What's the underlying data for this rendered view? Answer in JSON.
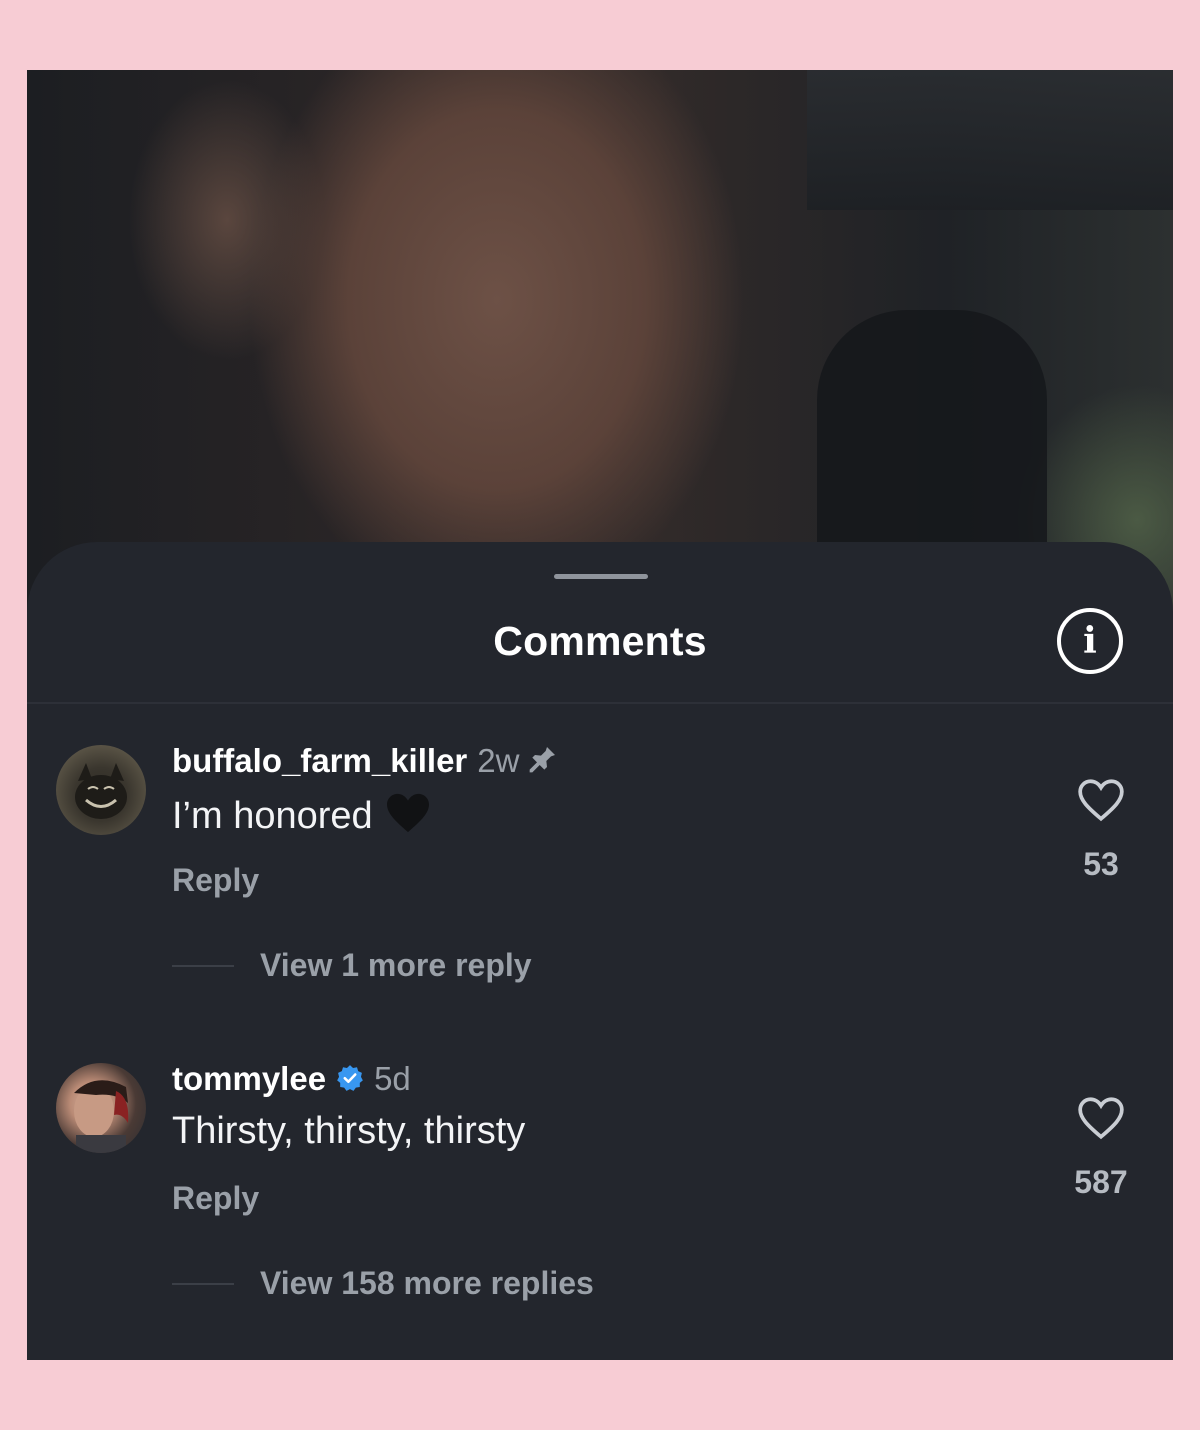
{
  "sheet": {
    "title": "Comments"
  },
  "comments": [
    {
      "username": "buffalo_farm_killer",
      "time": "2w",
      "pinned": true,
      "verified": false,
      "text": "I’m honored",
      "emoji": "black-heart",
      "reply_label": "Reply",
      "likes": "53",
      "view_more": "View 1 more reply"
    },
    {
      "username": "tommylee",
      "time": "5d",
      "pinned": false,
      "verified": true,
      "text": "Thirsty, thirsty, thirsty",
      "reply_label": "Reply",
      "likes": "587",
      "view_more": "View 158 more replies"
    }
  ],
  "colors": {
    "page_border": "#f7ccd4",
    "sheet_bg": "#23262d",
    "muted_text": "#9aa0a8",
    "verified_blue": "#3897f0"
  },
  "icons": {
    "info": "info-circle-icon",
    "pin": "pin-icon",
    "verified": "verified-badge-icon",
    "like": "heart-outline-icon"
  }
}
